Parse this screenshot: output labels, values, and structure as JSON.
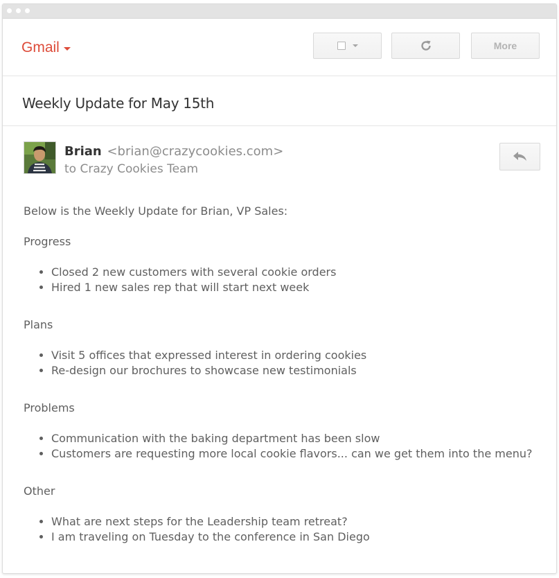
{
  "app": {
    "menu_label": "Gmail"
  },
  "toolbar": {
    "more_label": "More",
    "select_icon": "checkbox-icon",
    "refresh_icon": "refresh-icon"
  },
  "email": {
    "subject": "Weekly Update for May 15th",
    "sender_name": "Brian",
    "sender_email": "<brian@crazycookies.com>",
    "recipient": "to Crazy Cookies Team",
    "intro": "Below is the Weekly Update for Brian, VP Sales:",
    "sections": [
      {
        "title": "Progress",
        "items": [
          "Closed 2 new customers with several cookie orders",
          "Hired 1 new sales rep that will start next week"
        ]
      },
      {
        "title": "Plans",
        "items": [
          "Visit 5 offices that expressed interest in ordering cookies",
          "Re-design our brochures to showcase new testimonials"
        ]
      },
      {
        "title": "Problems",
        "items": [
          "Communication with the baking department has been slow",
          "Customers are requesting more local cookie flavors... can we get them into the menu?"
        ]
      },
      {
        "title": "Other",
        "items": [
          "What are next steps for the Leadership team retreat?",
          "I am traveling on Tuesday to the conference in San Diego"
        ]
      }
    ]
  },
  "colors": {
    "gmail_red": "#dd4b39",
    "text_dark": "#333333",
    "text_muted": "#8c8c8c",
    "body_text": "#5f5f5f"
  }
}
